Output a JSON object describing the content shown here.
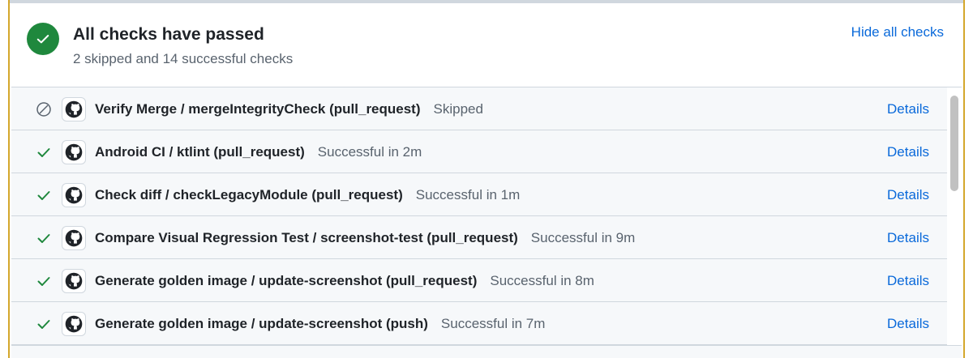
{
  "summary": {
    "title": "All checks have passed",
    "subtitle": "2 skipped and 14 successful checks",
    "hide_label": "Hide all checks"
  },
  "checks": [
    {
      "icon": "skipped-icon",
      "name": "Verify Merge / mergeIntegrityCheck (pull_request)",
      "status": "Skipped",
      "details": "Details"
    },
    {
      "icon": "check-icon",
      "name": "Android CI / ktlint (pull_request)",
      "status": "Successful in 2m",
      "details": "Details"
    },
    {
      "icon": "check-icon",
      "name": "Check diff / checkLegacyModule (pull_request)",
      "status": "Successful in 1m",
      "details": "Details"
    },
    {
      "icon": "check-icon",
      "name": "Compare Visual Regression Test / screenshot-test (pull_request)",
      "status": "Successful in 9m",
      "details": "Details"
    },
    {
      "icon": "check-icon",
      "name": "Generate golden image / update-screenshot (pull_request)",
      "status": "Successful in 8m",
      "details": "Details"
    },
    {
      "icon": "check-icon",
      "name": "Generate golden image / update-screenshot (push)",
      "status": "Successful in 7m",
      "details": "Details"
    }
  ],
  "colors": {
    "success": "#1f883d",
    "link": "#0969da",
    "muted": "#59636e",
    "highlight_border": "#d4a72c"
  }
}
